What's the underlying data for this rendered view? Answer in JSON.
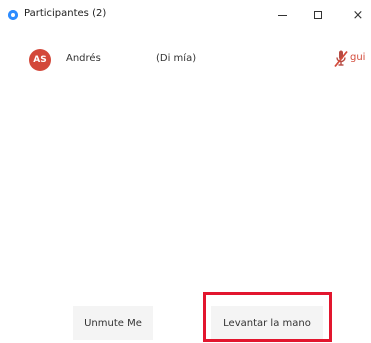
{
  "window": {
    "title": "Participantes (2)",
    "controls": {
      "minimize_icon": "minimize-icon",
      "maximize_icon": "maximize-icon",
      "close_icon": "close-icon",
      "close_glyph": "×"
    }
  },
  "participants": [
    {
      "initials": "AS",
      "name": "Andrés",
      "role": "(Di mía)",
      "status_icon": "muted-mic-icon",
      "clipped_text": "gui"
    }
  ],
  "actions": {
    "unmute_label": "Unmute Me",
    "raise_hand_label": "Levantar la mano"
  },
  "colors": {
    "avatar_bg": "#d3483a",
    "accent": "#2d8cff",
    "highlight": "#e2162e"
  }
}
